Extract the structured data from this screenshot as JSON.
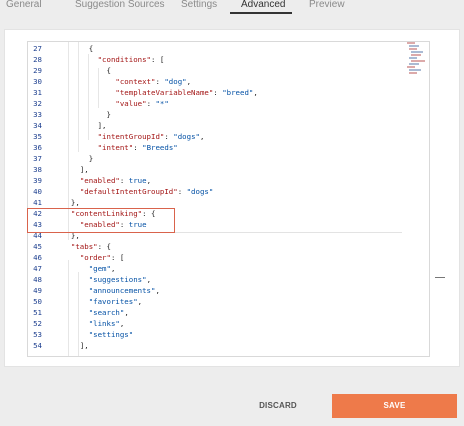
{
  "tabs": [
    {
      "label": "General",
      "active": false
    },
    {
      "label": "Suggestion Sources",
      "active": false
    },
    {
      "label": "Settings",
      "active": false
    },
    {
      "label": "Advanced",
      "active": true
    },
    {
      "label": "Preview",
      "active": false
    }
  ],
  "code_lines": [
    {
      "n": "27",
      "indent": "      ",
      "parts": [
        [
          "p",
          "{"
        ]
      ]
    },
    {
      "n": "28",
      "indent": "        ",
      "parts": [
        [
          "k",
          "\"conditions\""
        ],
        [
          "p",
          ": ["
        ]
      ]
    },
    {
      "n": "29",
      "indent": "          ",
      "parts": [
        [
          "p",
          "{"
        ]
      ]
    },
    {
      "n": "30",
      "indent": "            ",
      "parts": [
        [
          "k",
          "\"context\""
        ],
        [
          "p",
          ": "
        ],
        [
          "s",
          "\"dog\""
        ],
        [
          "p",
          ","
        ]
      ]
    },
    {
      "n": "31",
      "indent": "            ",
      "parts": [
        [
          "k",
          "\"templateVariableName\""
        ],
        [
          "p",
          ": "
        ],
        [
          "s",
          "\"breed\""
        ],
        [
          "p",
          ","
        ]
      ]
    },
    {
      "n": "32",
      "indent": "            ",
      "parts": [
        [
          "k",
          "\"value\""
        ],
        [
          "p",
          ": "
        ],
        [
          "s",
          "\"*\""
        ]
      ]
    },
    {
      "n": "33",
      "indent": "          ",
      "parts": [
        [
          "p",
          "}"
        ]
      ]
    },
    {
      "n": "34",
      "indent": "        ",
      "parts": [
        [
          "p",
          "],"
        ]
      ]
    },
    {
      "n": "35",
      "indent": "        ",
      "parts": [
        [
          "k",
          "\"intentGroupId\""
        ],
        [
          "p",
          ": "
        ],
        [
          "s",
          "\"dogs\""
        ],
        [
          "p",
          ","
        ]
      ]
    },
    {
      "n": "36",
      "indent": "        ",
      "parts": [
        [
          "k",
          "\"intent\""
        ],
        [
          "p",
          ": "
        ],
        [
          "s",
          "\"Breeds\""
        ]
      ]
    },
    {
      "n": "37",
      "indent": "      ",
      "parts": [
        [
          "p",
          "}"
        ]
      ]
    },
    {
      "n": "38",
      "indent": "    ",
      "parts": [
        [
          "p",
          "],"
        ]
      ]
    },
    {
      "n": "39",
      "indent": "    ",
      "parts": [
        [
          "k",
          "\"enabled\""
        ],
        [
          "p",
          ": "
        ],
        [
          "s",
          "true"
        ],
        [
          "p",
          ","
        ]
      ]
    },
    {
      "n": "40",
      "indent": "    ",
      "parts": [
        [
          "k",
          "\"defaultIntentGroupId\""
        ],
        [
          "p",
          ": "
        ],
        [
          "s",
          "\"dogs\""
        ]
      ]
    },
    {
      "n": "41",
      "indent": "  ",
      "parts": [
        [
          "p",
          "},"
        ]
      ]
    },
    {
      "n": "42",
      "indent": "  ",
      "parts": [
        [
          "k",
          "\"contentLinking\""
        ],
        [
          "p",
          ": {"
        ]
      ]
    },
    {
      "n": "43",
      "indent": "    ",
      "parts": [
        [
          "k",
          "\"enabled\""
        ],
        [
          "p",
          ": "
        ],
        [
          "s",
          "true"
        ]
      ]
    },
    {
      "n": "44",
      "indent": "  ",
      "parts": [
        [
          "p",
          "},"
        ]
      ]
    },
    {
      "n": "45",
      "indent": "  ",
      "parts": [
        [
          "k",
          "\"tabs\""
        ],
        [
          "p",
          ": {"
        ]
      ]
    },
    {
      "n": "46",
      "indent": "    ",
      "parts": [
        [
          "k",
          "\"order\""
        ],
        [
          "p",
          ": ["
        ]
      ]
    },
    {
      "n": "47",
      "indent": "      ",
      "parts": [
        [
          "s",
          "\"gem\""
        ],
        [
          "p",
          ","
        ]
      ]
    },
    {
      "n": "48",
      "indent": "      ",
      "parts": [
        [
          "s",
          "\"suggestions\""
        ],
        [
          "p",
          ","
        ]
      ]
    },
    {
      "n": "49",
      "indent": "      ",
      "parts": [
        [
          "s",
          "\"announcements\""
        ],
        [
          "p",
          ","
        ]
      ]
    },
    {
      "n": "50",
      "indent": "      ",
      "parts": [
        [
          "s",
          "\"favorites\""
        ],
        [
          "p",
          ","
        ]
      ]
    },
    {
      "n": "51",
      "indent": "      ",
      "parts": [
        [
          "s",
          "\"search\""
        ],
        [
          "p",
          ","
        ]
      ]
    },
    {
      "n": "52",
      "indent": "      ",
      "parts": [
        [
          "s",
          "\"links\""
        ],
        [
          "p",
          ","
        ]
      ]
    },
    {
      "n": "53",
      "indent": "      ",
      "parts": [
        [
          "s",
          "\"settings\""
        ]
      ]
    },
    {
      "n": "54",
      "indent": "    ",
      "parts": [
        [
          "p",
          "],"
        ]
      ]
    }
  ],
  "highlighted_lines": [
    "42",
    "43"
  ],
  "actions": {
    "discard_label": "DISCARD",
    "save_label": "SAVE"
  },
  "colors": {
    "accent": "#ee7a4a",
    "highlight_border": "#d9634c",
    "key": "#a31515",
    "string": "#0451a5",
    "line_number": "#1d3f8f"
  }
}
